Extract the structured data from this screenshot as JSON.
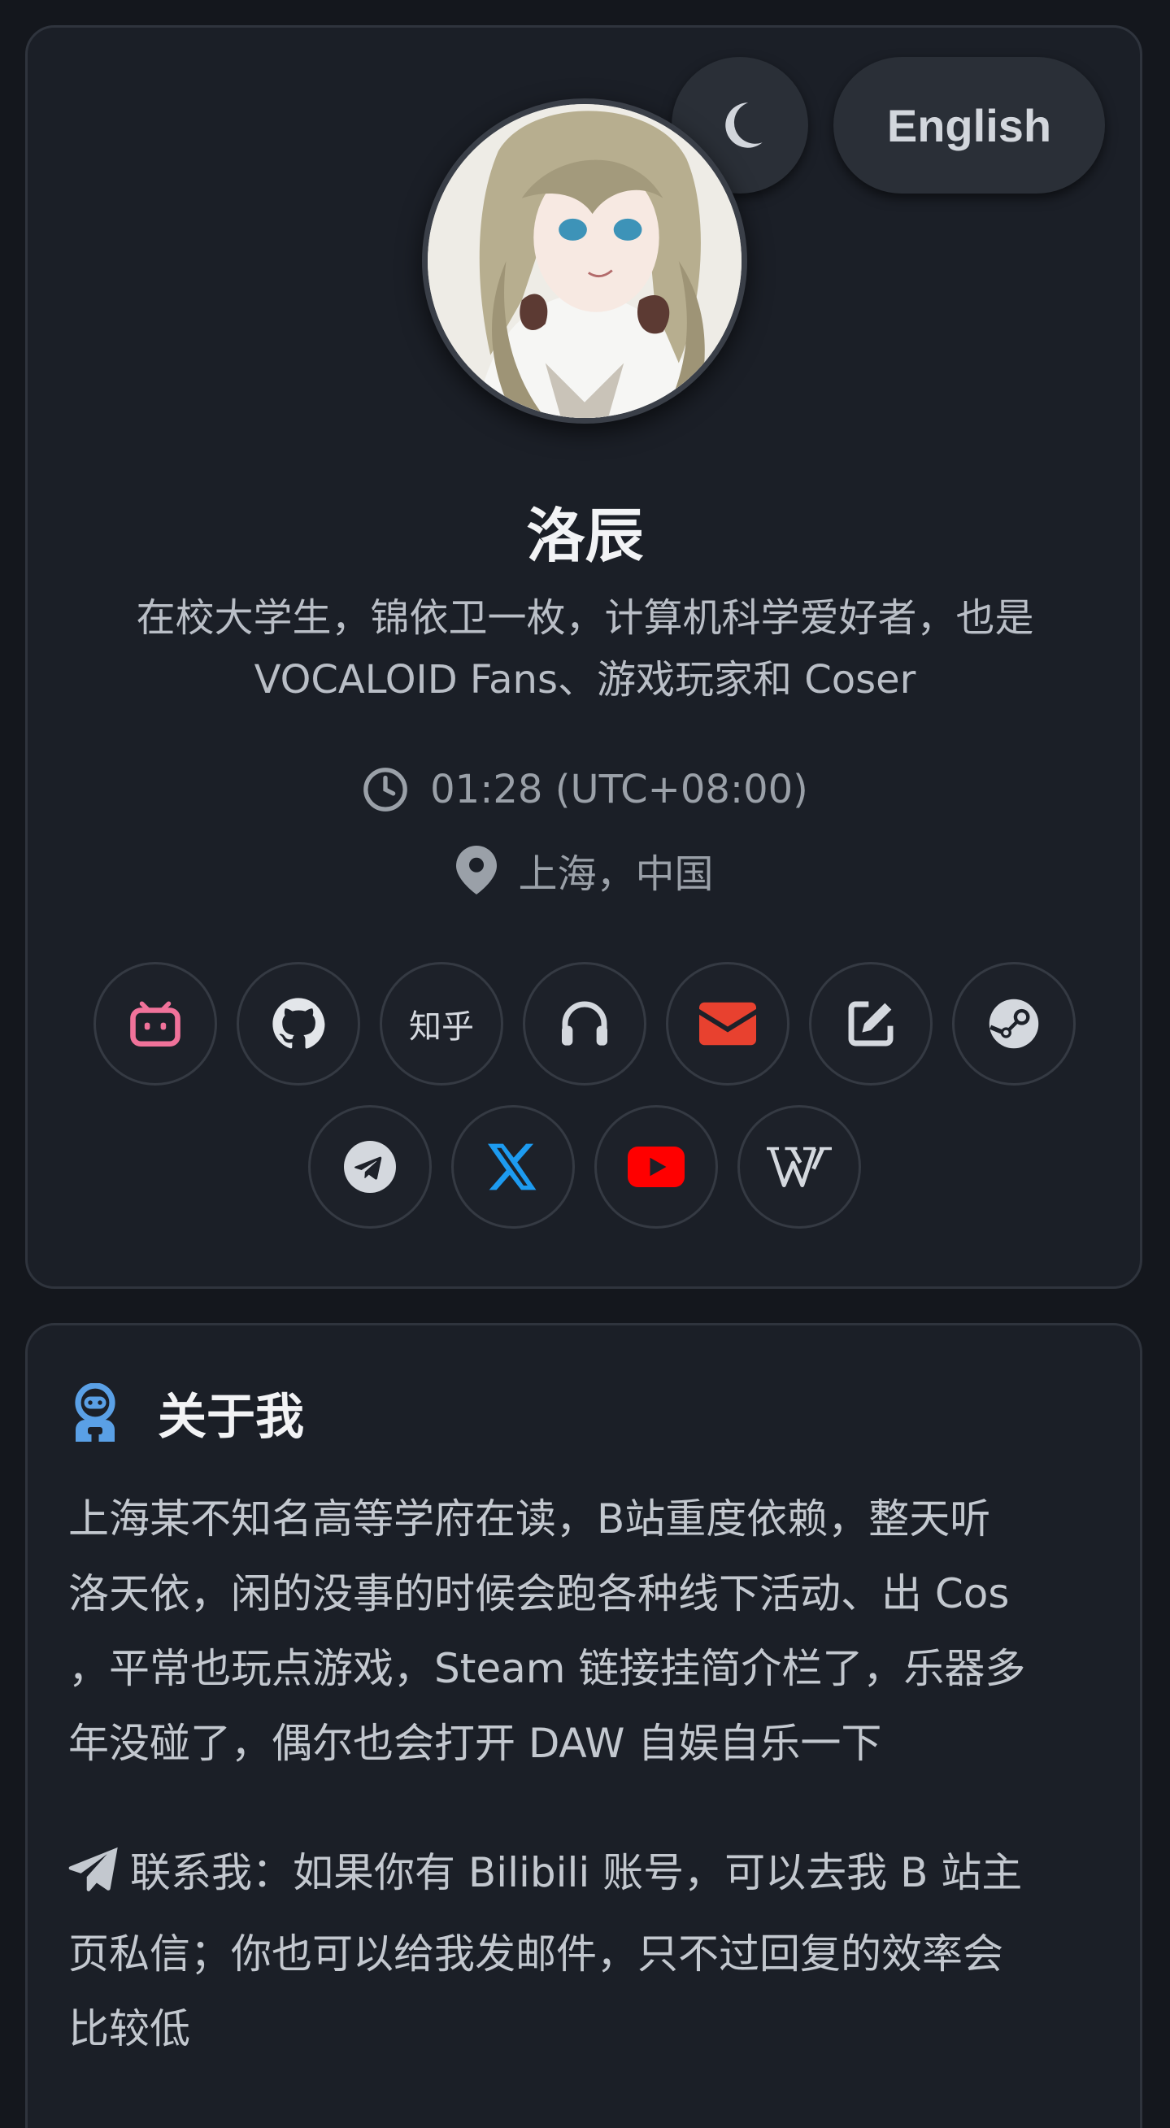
{
  "header": {
    "language_label": "English",
    "theme_icon": "moon-icon"
  },
  "profile": {
    "name": "洛辰",
    "bio_line1": "在校大学生，锦依卫一枚，计算机科学爱好者，也是",
    "bio_line2": "VOCALOID Fans、游戏玩家和 Coser",
    "time": "01:28 (UTC+08:00)",
    "location": "上海，中国"
  },
  "social_links": [
    {
      "icon": "bilibili-icon"
    },
    {
      "icon": "github-icon"
    },
    {
      "icon": "zhihu-icon",
      "label": "知乎"
    },
    {
      "icon": "headphones-icon"
    },
    {
      "icon": "email-icon"
    },
    {
      "icon": "edit-icon"
    },
    {
      "icon": "steam-icon"
    },
    {
      "icon": "telegram-icon"
    },
    {
      "icon": "x-icon"
    },
    {
      "icon": "youtube-icon"
    },
    {
      "icon": "wikipedia-icon"
    }
  ],
  "about": {
    "title": "关于我",
    "para1_lines": [
      "上海某不知名高等学府在读，B站重度依赖，整天听",
      "洛天依，闲的没事的时候会跑各种线下活动、出 Cos",
      "，平常也玩点游戏，Steam 链接挂简介栏了，乐器多",
      "年没碰了，偶尔也会打开 DAW 自娱自乐一下"
    ],
    "para2_lines": [
      "联系我：如果你有 Bilibili 账号，可以去我 B 站主",
      "页私信；你也可以给我发邮件，只不过回复的效率会",
      "比较低"
    ]
  },
  "colors": {
    "background": "#14171d",
    "card": "#1b1f27",
    "bilibili": "#f0729a",
    "email": "#e8412f",
    "x": "#1d9bf0",
    "youtube": "#ff0000",
    "about_icon": "#5aa0e6"
  }
}
